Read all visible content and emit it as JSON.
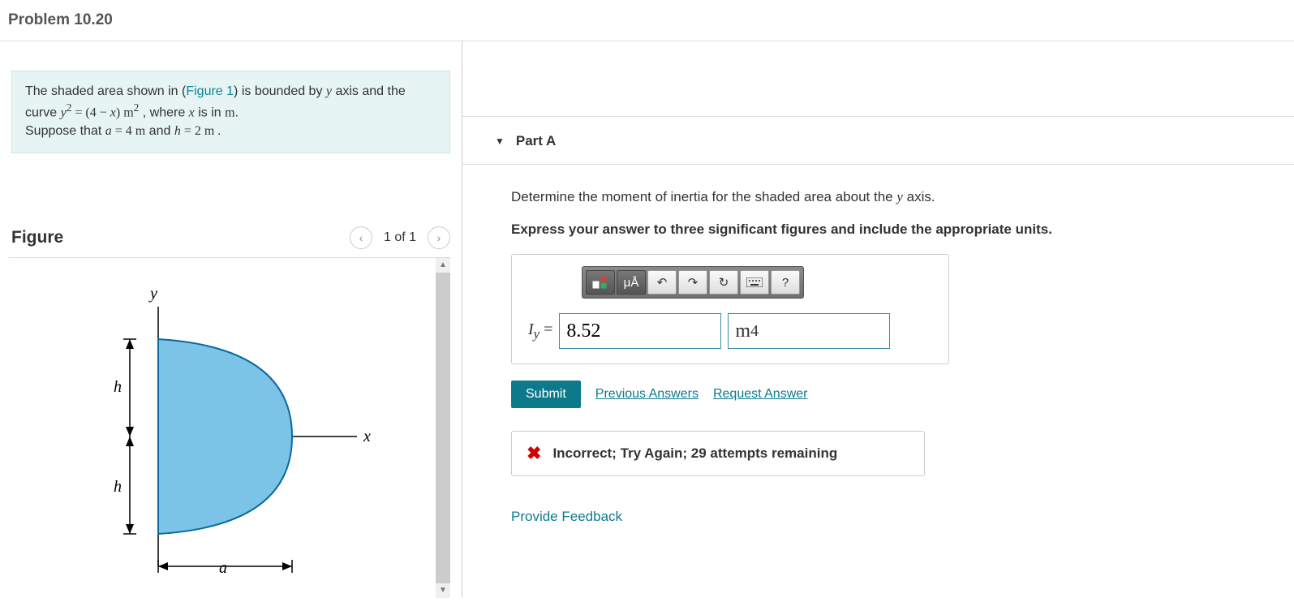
{
  "header": {
    "title": "Problem 10.20"
  },
  "problem": {
    "prefix": "The shaded area shown in (",
    "figure_link": "Figure 1",
    "after_link": ") is bounded by ",
    "y_var": "y",
    "axis_text": " axis and the curve ",
    "equation_lhs": "y",
    "equation_exp1": "2",
    "equals": " = ",
    "equation_rhs1": "(4 − ",
    "equation_x": "x",
    "equation_rhs2": ") m",
    "equation_exp2": "2",
    "where": " , where ",
    "x_var": "x",
    "isin": " is in ",
    "m_unit": "m",
    "period": ".",
    "suppose": "Suppose that ",
    "a_var": "a",
    "a_val": " = 4  m",
    "and": " and ",
    "h_var": "h",
    "h_val": " = 2  m ."
  },
  "figure": {
    "title": "Figure",
    "nav_text": "1 of 1",
    "labels": {
      "y": "y",
      "x": "x",
      "h": "h",
      "a": "a"
    }
  },
  "part": {
    "title": "Part A",
    "instruction_prefix": "Determine the moment of inertia for the shaded area about the ",
    "instruction_var": "y",
    "instruction_suffix": " axis.",
    "bold_instruction": "Express your answer to three significant figures and include the appropriate units.",
    "answer_label_var": "I",
    "answer_label_sub": "y",
    "answer_label_eq": " = ",
    "value_input": "8.52",
    "unit_base": "m",
    "unit_exp": "4",
    "toolbar": {
      "mu_a": "μÅ",
      "help": "?"
    },
    "submit": "Submit",
    "prev_answers": "Previous Answers",
    "request_answer": "Request Answer",
    "feedback": "Incorrect; Try Again; 29 attempts remaining"
  },
  "footer": {
    "provide_feedback": "Provide Feedback"
  }
}
